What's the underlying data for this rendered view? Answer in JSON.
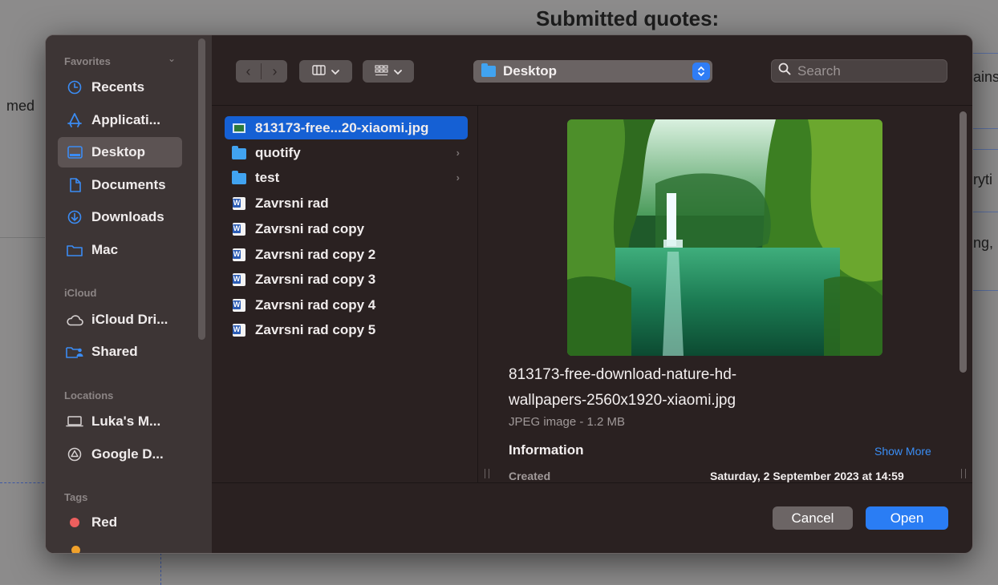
{
  "background": {
    "title": "Submitted quotes:",
    "fragments": [
      "med",
      "ains",
      "ryti",
      "ng,"
    ]
  },
  "sidebar": {
    "favorites_label": "Favorites",
    "icloud_label": "iCloud",
    "locations_label": "Locations",
    "tags_label": "Tags",
    "favorites": [
      {
        "label": "Recents",
        "icon": "clock-icon"
      },
      {
        "label": "Applicati...",
        "icon": "applications-icon"
      },
      {
        "label": "Desktop",
        "icon": "desktop-icon",
        "selected": true
      },
      {
        "label": "Documents",
        "icon": "document-icon"
      },
      {
        "label": "Downloads",
        "icon": "download-icon"
      },
      {
        "label": "Mac",
        "icon": "folder-icon"
      }
    ],
    "icloud": [
      {
        "label": "iCloud Dri...",
        "icon": "cloud-icon"
      },
      {
        "label": "Shared",
        "icon": "shared-folder-icon"
      }
    ],
    "locations": [
      {
        "label": "Luka's M...",
        "icon": "laptop-icon"
      },
      {
        "label": "Google D...",
        "icon": "drive-icon"
      }
    ],
    "tags": [
      {
        "label": "Red",
        "color": "#ec5f5e"
      }
    ]
  },
  "toolbar": {
    "location": "Desktop",
    "search_placeholder": "Search"
  },
  "files": [
    {
      "name": "813173-free...20-xiaomi.jpg",
      "type": "image",
      "selected": true
    },
    {
      "name": "quotify",
      "type": "folder"
    },
    {
      "name": "test",
      "type": "folder"
    },
    {
      "name": "Zavrsni rad",
      "type": "word"
    },
    {
      "name": "Zavrsni rad copy",
      "type": "word"
    },
    {
      "name": "Zavrsni rad copy 2",
      "type": "word"
    },
    {
      "name": "Zavrsni rad copy 3",
      "type": "word"
    },
    {
      "name": "Zavrsni rad copy 4",
      "type": "word"
    },
    {
      "name": "Zavrsni rad copy 5",
      "type": "word"
    }
  ],
  "preview": {
    "name_line1": "813173-free-download-nature-hd-",
    "name_line2": "wallpapers-2560x1920-xiaomi.jpg",
    "kind": "JPEG image - 1.2 MB",
    "info_label": "Information",
    "show_more": "Show More",
    "created_label": "Created",
    "created_value": "Saturday, 2 September 2023 at 14:59"
  },
  "buttons": {
    "cancel": "Cancel",
    "open": "Open"
  },
  "colors": {
    "accent": "#2a7df4",
    "selection": "#1560d4",
    "sidebar_bg": "#3d3535",
    "dialog_bg": "#2a2121"
  }
}
